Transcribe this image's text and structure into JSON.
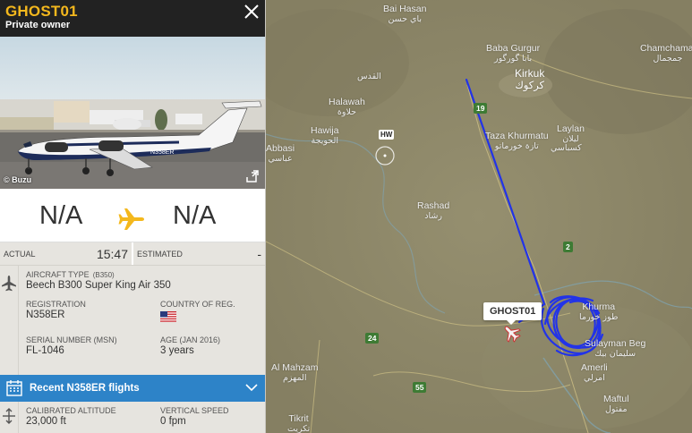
{
  "flight": {
    "callsign": "GHOST01",
    "owner": "Private owner",
    "photo_credit": "© Buzu",
    "photo_registration": "N358ER",
    "origin": "N/A",
    "destination": "N/A"
  },
  "times": {
    "actual_label": "ACTUAL",
    "actual_value": "15:47",
    "estimated_label": "ESTIMATED",
    "estimated_value": "-"
  },
  "aircraft": {
    "type_label": "AIRCRAFT TYPE",
    "type_code": "(B350)",
    "type_value": "Beech B300 Super King Air 350",
    "registration_label": "REGISTRATION",
    "registration_value": "N358ER",
    "country_label": "COUNTRY OF REG.",
    "msn_label": "SERIAL NUMBER (MSN)",
    "msn_value": "FL-1046",
    "age_label": "AGE (JAN 2016)",
    "age_value": "3 years"
  },
  "recent_flights_label": "Recent N358ER flights",
  "altitude": {
    "calibrated_label": "CALIBRATED ALTITUDE",
    "calibrated_value": "23,000 ft",
    "vspeed_label": "VERTICAL SPEED",
    "vspeed_value": "0 fpm"
  },
  "map": {
    "callsign_tag": "GHOST01",
    "hw_marker": "HW",
    "cities": [
      {
        "name": "Bai Hasan",
        "ar": "باي حسن"
      },
      {
        "name": "Baba Gurgur",
        "ar": "بابا گورگور"
      },
      {
        "name": "Kirkuk",
        "ar": "كركوك"
      },
      {
        "name": "Chamchamal",
        "ar": "جمجمال"
      },
      {
        "name": "",
        "ar": "القدس"
      },
      {
        "name": "Halawah",
        "ar": "حلاوة"
      },
      {
        "name": "Hawija",
        "ar": "الحويجة"
      },
      {
        "name": "Abbasi",
        "ar": "عباسي"
      },
      {
        "name": "Taza Khurmatu",
        "ar": "تازة خورماتو"
      },
      {
        "name": "Laylan",
        "ar": "ليلان"
      },
      {
        "name": "",
        "ar": "كسباسي"
      },
      {
        "name": "Rashad",
        "ar": "رشاد"
      },
      {
        "name": "Khurma",
        "ar": "طوز خورما"
      },
      {
        "name": "Sulayman Beg",
        "ar": "سليمان بيك"
      },
      {
        "name": "Amerli",
        "ar": "امرلي"
      },
      {
        "name": "Al Mahzam",
        "ar": "المهزم"
      },
      {
        "name": "Maftul",
        "ar": "مفتول"
      },
      {
        "name": "Tikrit",
        "ar": "تكريت"
      }
    ],
    "roads": [
      "19",
      "2",
      "24",
      "55"
    ]
  },
  "colors": {
    "callsign": "#f4b81d",
    "track": "#2233e8",
    "accent_bar": "#2d83c8",
    "plane_icon": "#f4b81d"
  },
  "icons": [
    "close-icon",
    "expand-icon",
    "airplane-icon",
    "aircraft-icon",
    "calendar-icon",
    "chevron-down-icon",
    "altitude-icon",
    "us-flag-icon"
  ]
}
